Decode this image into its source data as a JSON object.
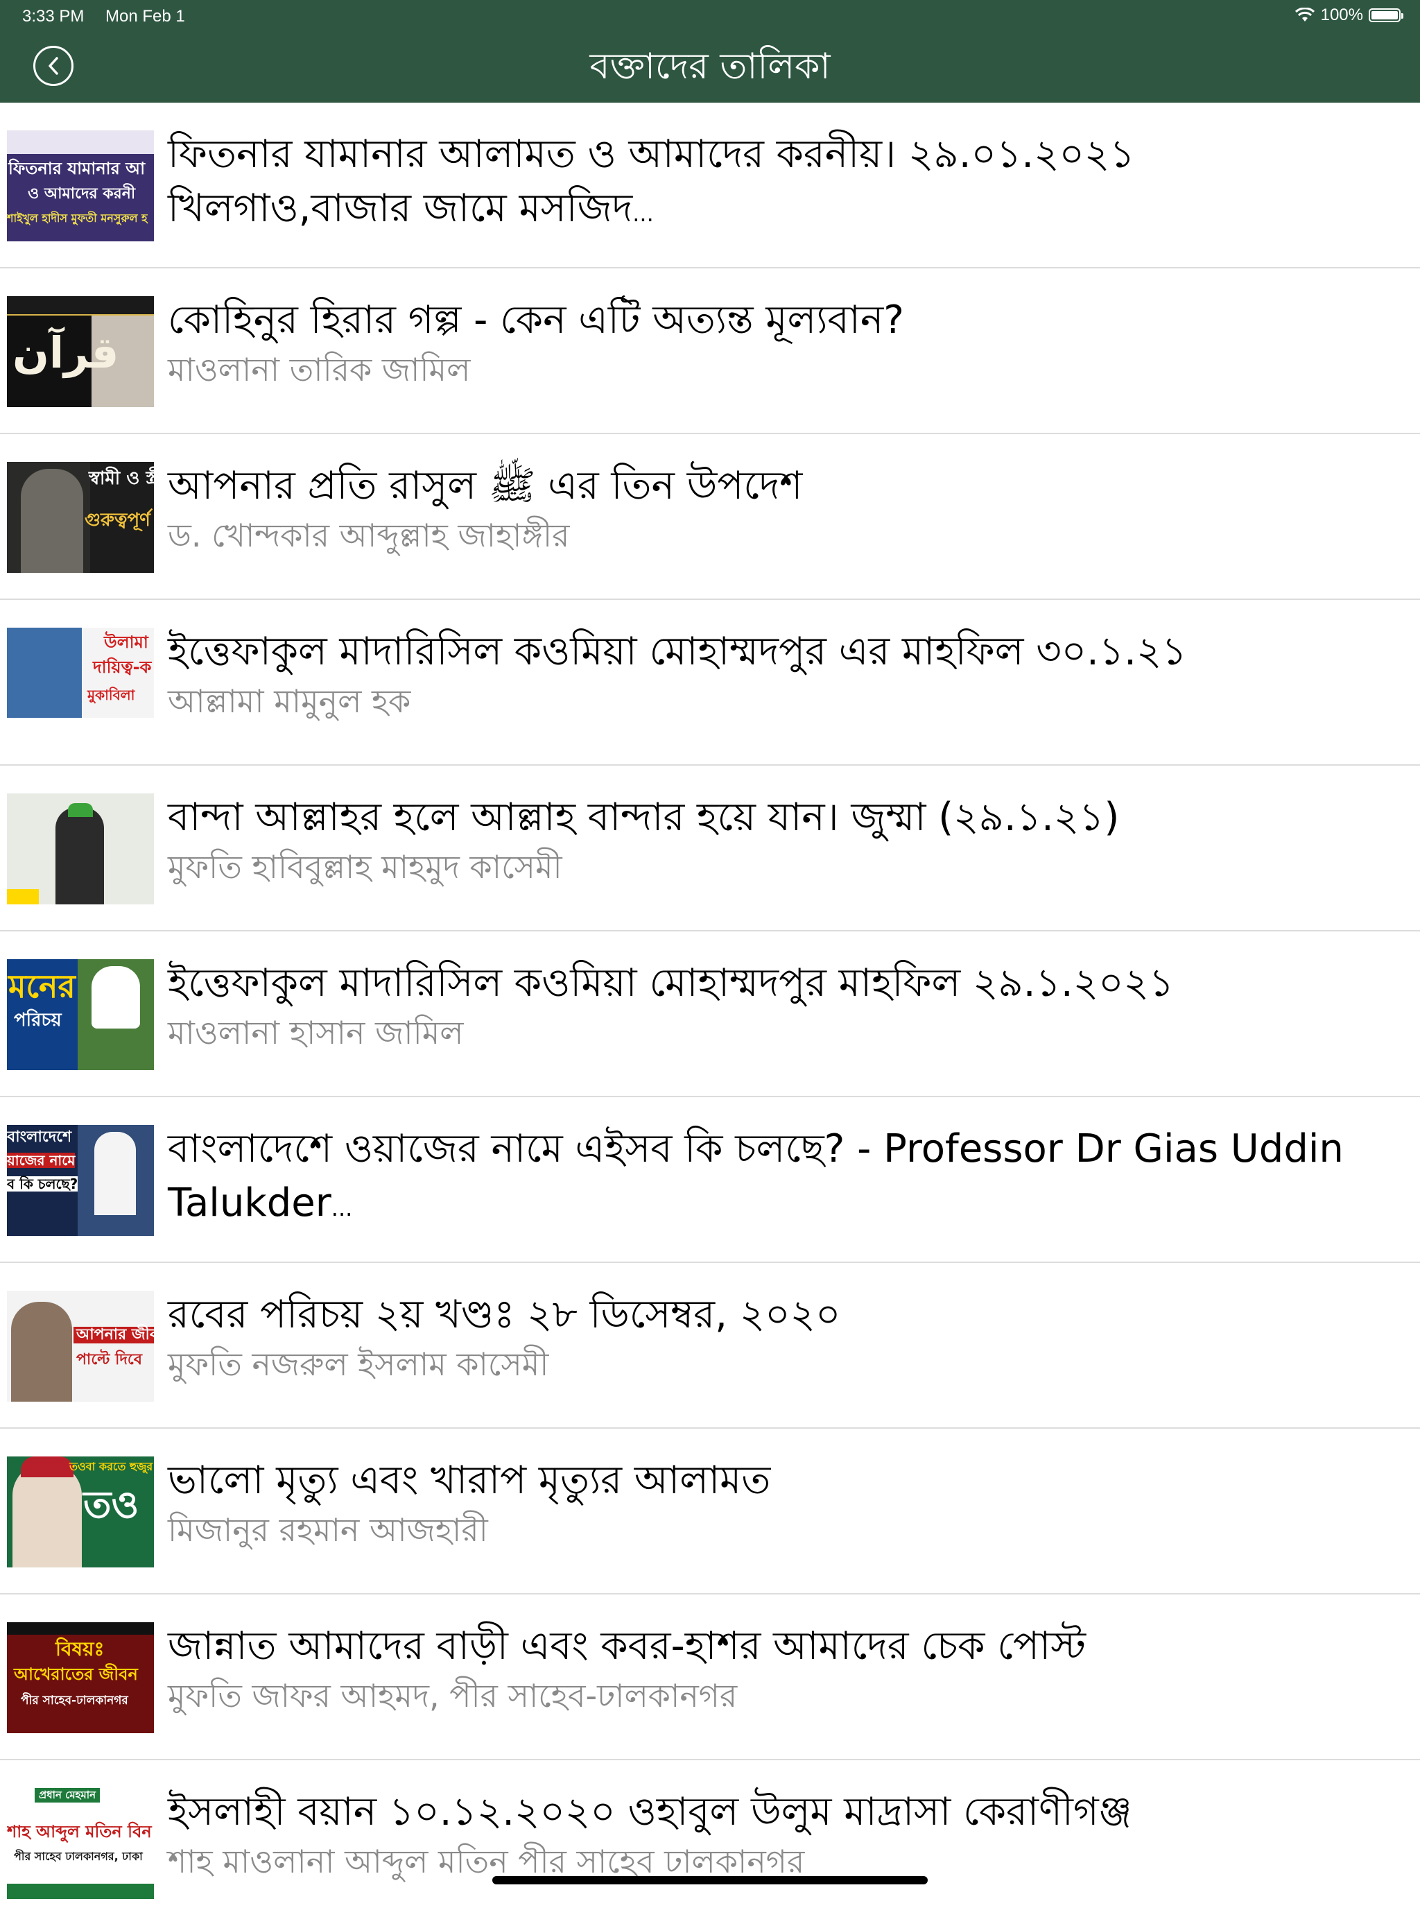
{
  "status_bar": {
    "time": "3:33 PM",
    "date": "Mon Feb 1",
    "battery": "100%"
  },
  "nav": {
    "title": "বক্তাদের তালিকা"
  },
  "lectures": [
    {
      "title": "ফিতনার যামানার আলামত ও আমাদের করনীয়। ২৯.০১.২০২১ খিলগাও,বাজার জামে মসজিদ",
      "speaker": "",
      "thumb_lines": [
        "ফিতনার যামানার আ",
        "ও আমাদের করনী",
        "শাইখুল হাদীস মুফতী মনসুরুল হ"
      ]
    },
    {
      "title": "কোহিনুর হিরার গল্প - কেন এটি অত্যন্ত মূল্যবান?",
      "speaker": "মাওলানা তারিক জামিল",
      "thumb_lines": [
        "قرآن",
        "",
        ""
      ]
    },
    {
      "title": "আপনার প্রতি রাসুল ﷺ এর তিন উপদেশ",
      "speaker": "ড. খোন্দকার আব্দুল্লাহ জাহাঙ্গীর",
      "thumb_lines": [
        "স্বামী ও স্ত্রী",
        "গুরুত্বপূর্ণ",
        ""
      ]
    },
    {
      "title": "ইত্তেফাকুল মাদারিসিল কওমিয়া মোহাম্মদপুর এর মাহফিল ৩০.১.২১",
      "speaker": "আল্লামা মামুনুল হক",
      "thumb_lines": [
        "উলামা",
        "দায়িত্ব-ক",
        "মুকাবিলা"
      ]
    },
    {
      "title": "বান্দা আল্লাহর হলে আল্লাহ বান্দার হয়ে যান। জুম্মা (২৯.১.২১)",
      "speaker": "মুফতি হাবিবুল্লাহ মাহমুদ কাসেমী",
      "thumb_lines": [
        "",
        "",
        ""
      ]
    },
    {
      "title": "ইত্তেফাকুল মাদারিসিল কওমিয়া মোহাম্মদপুর মাহফিল ২৯.১.২০২১",
      "speaker": "মাওলানা হাসান জামিল",
      "thumb_lines": [
        "মনের",
        "পরিচয়",
        ""
      ]
    },
    {
      "title": "বাংলাদেশে ওয়াজের নামে এইসব কি চলছে? - Professor Dr Gias Uddin Talukder",
      "speaker": "",
      "thumb_lines": [
        "বাংলাদেশে",
        "য়াজের নামে",
        "ব কি চলছে?"
      ]
    },
    {
      "title": "রবের পরিচয় ২য় খণ্ডঃ ২৮ ডিসেম্বর, ২০২০",
      "speaker": "মুফতি নজরুল ইসলাম কাসেমী",
      "thumb_lines": [
        "আপনার জীব",
        "পাল্টে দিবে",
        ""
      ]
    },
    {
      "title": "ভালো মৃত্যু এবং খারাপ মৃত্যুর আলামত",
      "speaker": "মিজানুর রহমান আজহারী",
      "thumb_lines": [
        "তওবা করতে হুজুর লাগে",
        "তও",
        ""
      ]
    },
    {
      "title": "জান্নাত আমাদের বাড়ী এবং কবর-হাশর আমাদের চেক পোস্ট",
      "speaker": "মুফতি জাফর আহমদ, পীর সাহেব-ঢালকানগর",
      "thumb_lines": [
        "বিষয়ঃ",
        "আখেরাতের জীবন",
        "পীর সাহেব-ঢালকানগর"
      ]
    },
    {
      "title": "ইসলাহী বয়ান ১০.১২.২০২০ ওহাবুল উলুম মাদ্রাসা কেরাণীগঞ্জ",
      "speaker": "শাহ মাওলানা আব্দুল মতিন পীর সাহেব ঢালকানগর",
      "thumb_lines": [
        "প্রধান মেহমান",
        "শাহ আব্দুল মতিন বিন হুসাইন",
        "পীর সাহেব ঢালকানগর, ঢাকা"
      ]
    }
  ],
  "colors": {
    "nav_bg": "#2e5641",
    "title_text": "#000000",
    "speaker_text": "#8a8a8a",
    "divider": "#dcdcdc"
  }
}
